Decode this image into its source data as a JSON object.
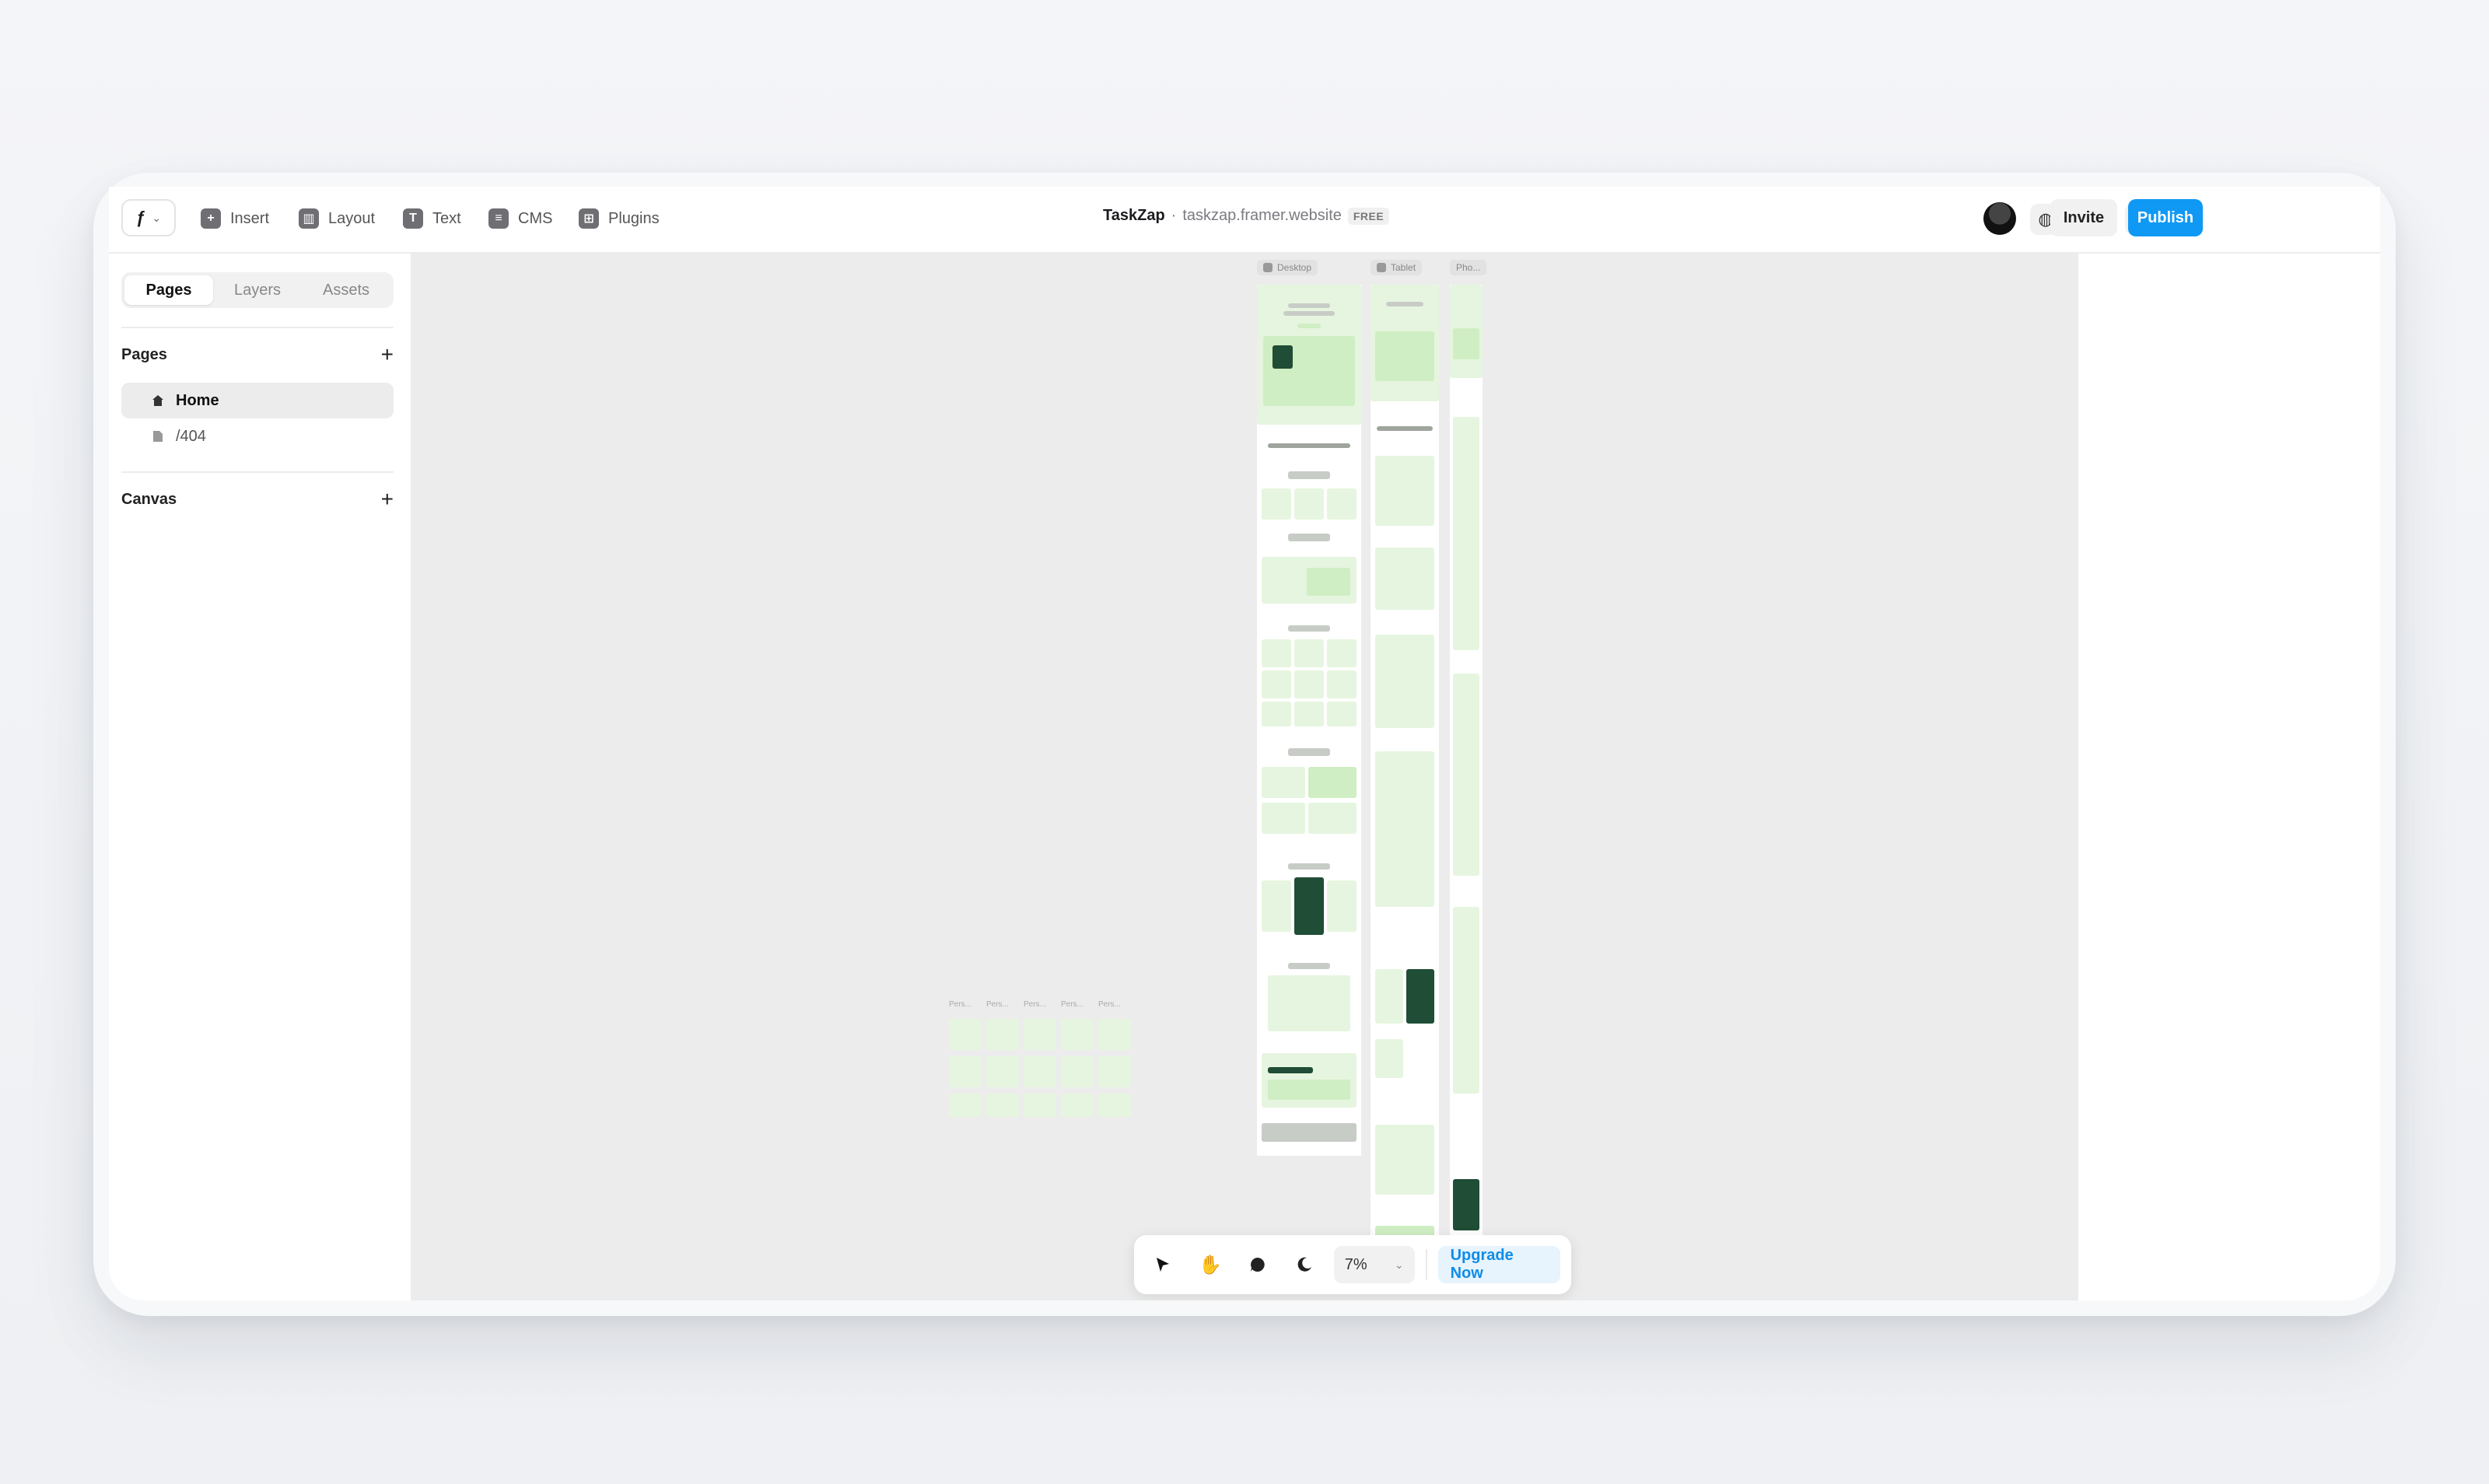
{
  "toolbar": {
    "insert": "Insert",
    "layout": "Layout",
    "text": "Text",
    "cms": "CMS",
    "plugins": "Plugins"
  },
  "project": {
    "name": "TaskZap",
    "separator": "·",
    "domain": "taskzap.framer.website",
    "plan_badge": "FREE"
  },
  "actions": {
    "invite": "Invite",
    "publish": "Publish"
  },
  "sidebar": {
    "tabs": [
      "Pages",
      "Layers",
      "Assets"
    ],
    "active_tab": "Pages",
    "pages_heading": "Pages",
    "pages": [
      {
        "label": "Home",
        "icon": "home-icon",
        "active": true
      },
      {
        "label": "/404",
        "icon": "page-icon",
        "active": false
      }
    ],
    "canvas_heading": "Canvas"
  },
  "canvas": {
    "breakpoints": [
      "Desktop",
      "Tablet",
      "Pho..."
    ],
    "component_label": "Pers..."
  },
  "bottom_tools": {
    "zoom": "7%",
    "upgrade": "Upgrade Now"
  },
  "colors": {
    "accent": "#0f99f5",
    "canvas_bg": "#ececec",
    "site_green": "#cfeec3",
    "site_dark_green": "#1f4d35"
  }
}
